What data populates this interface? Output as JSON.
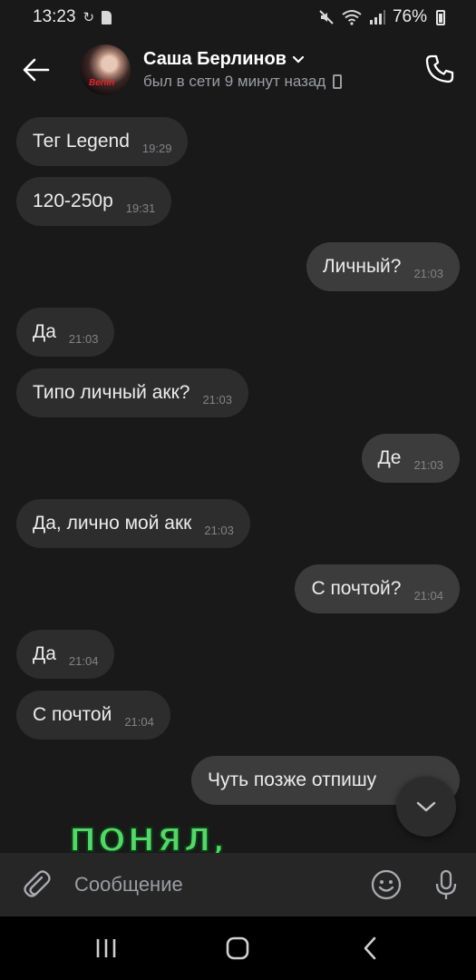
{
  "status_bar": {
    "time": "13:23",
    "battery": "76%"
  },
  "header": {
    "contact_name": "Саша Берлинов",
    "last_seen": "был в сети 9 минут назад",
    "avatar_text": "Berlin"
  },
  "messages": [
    {
      "direction": "in",
      "text": "Тег Legend",
      "time": "19:29"
    },
    {
      "direction": "in",
      "text": "120-250р",
      "time": "19:31"
    },
    {
      "direction": "out",
      "text": "Личный?",
      "time": "21:03"
    },
    {
      "direction": "in",
      "text": "Да",
      "time": "21:03"
    },
    {
      "direction": "in",
      "text": "Типо личный акк?",
      "time": "21:03"
    },
    {
      "direction": "out",
      "text": "Де",
      "time": "21:03"
    },
    {
      "direction": "in",
      "text": "Да, лично мой акк",
      "time": "21:03"
    },
    {
      "direction": "out",
      "text": "С почтой?",
      "time": "21:04"
    },
    {
      "direction": "in",
      "text": "Да",
      "time": "21:04"
    },
    {
      "direction": "in",
      "text": "С почтой",
      "time": "21:04"
    },
    {
      "direction": "out",
      "text": "Чуть позже отпишу",
      "time": ""
    }
  ],
  "sticker_text": "ПОНЯЛ,",
  "composer": {
    "placeholder": "Сообщение"
  },
  "colors": {
    "background": "#19191a",
    "incoming_bubble": "#2d2d2e",
    "outgoing_bubble": "#3c3c3d",
    "sticker": "#52d868"
  }
}
